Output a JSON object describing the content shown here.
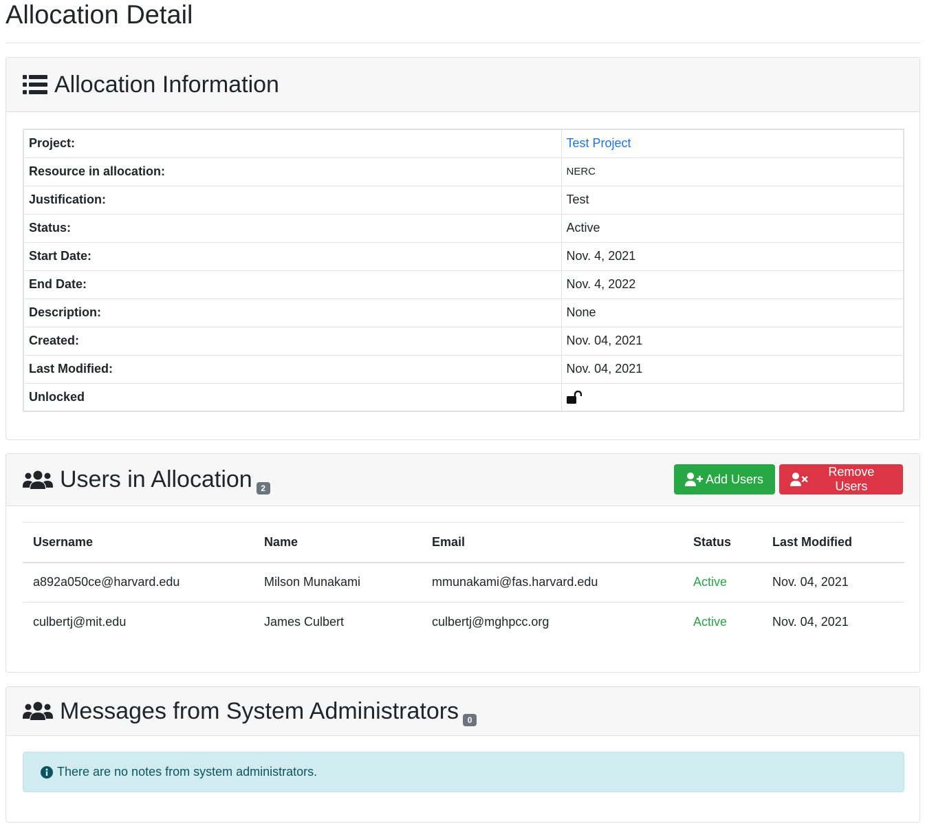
{
  "page": {
    "title": "Allocation Detail"
  },
  "allocation_info": {
    "header": "Allocation Information",
    "rows": [
      {
        "label": "Project:",
        "value": "Test Project"
      },
      {
        "label": "Resource in allocation:",
        "value": "NERC"
      },
      {
        "label": "Justification:",
        "value": "Test"
      },
      {
        "label": "Status:",
        "value": "Active"
      },
      {
        "label": "Start Date:",
        "value": "Nov. 4, 2021"
      },
      {
        "label": "End Date:",
        "value": "Nov. 4, 2022"
      },
      {
        "label": "Description:",
        "value": "None"
      },
      {
        "label": "Created:",
        "value": "Nov. 04, 2021"
      },
      {
        "label": "Last Modified:",
        "value": "Nov. 04, 2021"
      },
      {
        "label": "Unlocked",
        "icon": "unlock-icon"
      }
    ]
  },
  "users": {
    "header": "Users in Allocation",
    "count": "2",
    "add_label": "Add Users",
    "remove_label": "Remove Users",
    "columns": [
      "Username",
      "Name",
      "Email",
      "Status",
      "Last Modified"
    ],
    "rows": [
      [
        "a892a050ce@harvard.edu",
        "Milson Munakami",
        "mmunakami@fas.harvard.edu",
        "Active",
        "Nov. 04, 2021"
      ],
      [
        "culbertj@mit.edu",
        "James Culbert",
        "culbertj@mghpcc.org",
        "Active",
        "Nov. 04, 2021"
      ]
    ]
  },
  "messages": {
    "header": "Messages from System Administrators",
    "count": "0",
    "alert": "There are no notes from system administrators."
  },
  "colors": {
    "success": "#28a745",
    "danger": "#dc3545",
    "link": "#1a73e8",
    "info_bg": "#d1ecf1",
    "badge": "#6c757d"
  }
}
